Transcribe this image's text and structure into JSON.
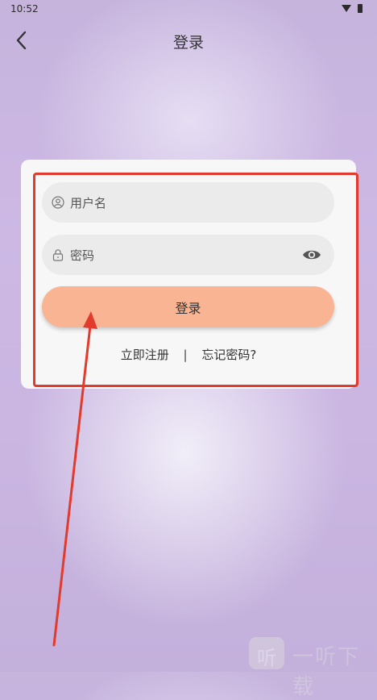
{
  "status_bar": {
    "time": "10:52"
  },
  "header": {
    "title": "登录"
  },
  "form": {
    "username_placeholder": "用户名",
    "password_placeholder": "密码",
    "login_label": "登录",
    "register_link": "立即注册",
    "separator": "|",
    "forgot_link": "忘记密码?"
  },
  "watermark": {
    "logo": "听",
    "text": "一听下载"
  },
  "icons": {
    "back": "chevron-left-icon",
    "user": "user-icon",
    "lock": "lock-icon",
    "eye": "eye-icon"
  },
  "colors": {
    "accent_button": "#f8b493",
    "highlight": "#e23a2c",
    "card": "#f7f7f7",
    "field": "#ebebeb"
  }
}
